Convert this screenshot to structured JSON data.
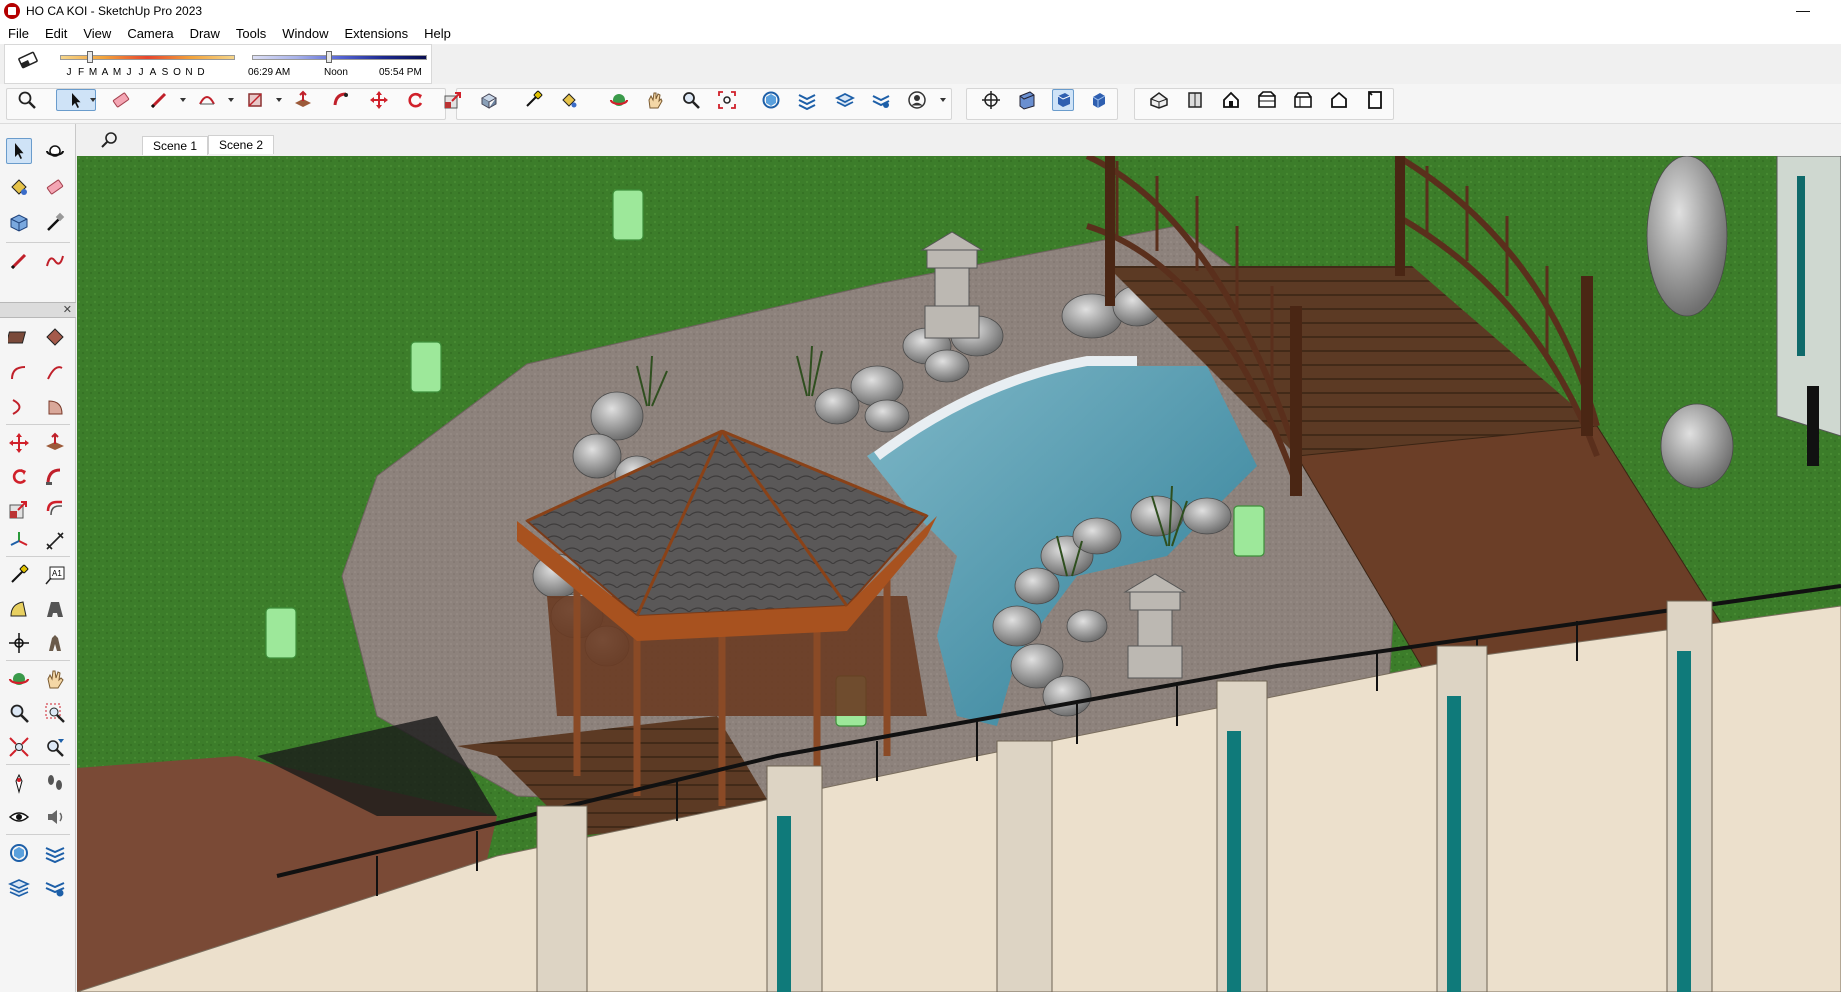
{
  "window": {
    "title": "HO CA KOI  - SketchUp Pro 2023",
    "minimize_glyph": "—"
  },
  "menu": [
    "File",
    "Edit",
    "View",
    "Camera",
    "Draw",
    "Tools",
    "Window",
    "Extensions",
    "Help"
  ],
  "shadows": {
    "months": [
      "J",
      "F",
      "M",
      "A",
      "M",
      "J",
      "J",
      "A",
      "S",
      "O",
      "N",
      "D"
    ],
    "sunrise": "06:29 AM",
    "noon": "Noon",
    "sunset": "05:54 PM"
  },
  "scenes": {
    "tabs": [
      "Scene 1",
      "Scene 2"
    ]
  },
  "icons": {
    "top_toolbar": [
      "zoom-extents-icon",
      "select-icon",
      "eraser-icon",
      "pencil-icon",
      "arc-icon",
      "rectangle-icon",
      "push-pull-icon",
      "follow-me-icon",
      "move-icon",
      "rotate-icon",
      "scale-icon",
      "offset-icon",
      "tape-measure-icon",
      "paint-bucket-icon",
      "orbit-icon",
      "pan-icon",
      "zoom-icon",
      "zoom-window-icon",
      "3d-warehouse-icon",
      "extension-warehouse-icon",
      "layout-icon",
      "extension-manager-icon",
      "account-icon",
      "section-plane-icon",
      "display-section-icon",
      "section-cuts-icon",
      "section-fill-icon",
      "iso-view-icon",
      "top-view-icon",
      "front-view-icon",
      "right-view-icon",
      "back-view-icon",
      "left-view-icon",
      "bottom-view-icon"
    ],
    "left_toolbar": [
      "select-icon",
      "orbit-icon",
      "paint-bucket-icon",
      "eraser-icon",
      "component-icon",
      "tape-measure-icon",
      "line-icon",
      "freehand-icon",
      "rectangle-icon",
      "rotated-rectangle-icon",
      "arc-icon",
      "pie-icon",
      "move-icon",
      "push-pull-icon",
      "rotate-icon",
      "follow-me-icon",
      "scale-icon",
      "offset-icon",
      "axes-icon",
      "text-icon",
      "protractor-icon",
      "3d-text-icon",
      "position-camera-icon",
      "walk-icon",
      "look-around-icon",
      "pan-icon",
      "zoom-icon",
      "zoom-window-icon",
      "zoom-extents-icon",
      "previous-view-icon"
    ]
  },
  "colors": {
    "accent": "#6a9ccc",
    "grass": "#3b7a2a",
    "paving": "#8a7f7a",
    "water": "#3f8aa3",
    "wood": "#6b3a1e"
  }
}
